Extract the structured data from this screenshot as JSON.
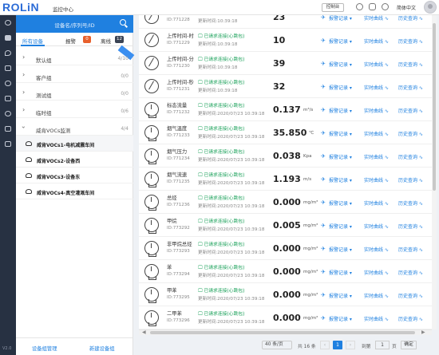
{
  "header": {
    "brand": "ROLiN",
    "app_title": "监控中心",
    "control_label": "控制台",
    "language": "简体中文"
  },
  "sidebar_rail": {
    "version": "V2.0"
  },
  "left_panel": {
    "search_placeholder": "设备名/序列号/ID",
    "tabs": [
      {
        "label": "所有设备",
        "active": true
      },
      {
        "label": "报警",
        "count": "0",
        "color": "#e8602c"
      },
      {
        "label": "离线",
        "count": "12",
        "color": "#3a4354"
      }
    ],
    "groups": [
      {
        "label": "默认组",
        "count": "4/10"
      },
      {
        "label": "客户组",
        "count": "0/0"
      },
      {
        "label": "测试组",
        "count": "0/0"
      },
      {
        "label": "临时组",
        "count": "0/6"
      },
      {
        "label": "威肯VOCs监测",
        "count": "4/4",
        "expanded": true
      }
    ],
    "devices": [
      {
        "label": "威肯VOCs1-电机减震车间"
      },
      {
        "label": "威肯VOCs2-设备西"
      },
      {
        "label": "威肯VOCs3-设备东"
      },
      {
        "label": "威肯VOCs4-真空灌溉车间"
      }
    ],
    "footer": {
      "manage": "设备组管理",
      "add": "新建设备组"
    }
  },
  "rows": [
    {
      "name": "上传时间-时",
      "id": "ID:771228",
      "status": "已请求连接(心跳包)",
      "time": "更新时间:10:39:18",
      "value": "23",
      "unit": "",
      "icon": "compass-icon"
    },
    {
      "name": "上传时间-时",
      "id": "ID:771229",
      "status": "已请求连接(心跳包)",
      "time": "更新时间:10:39:18",
      "value": "10",
      "unit": "",
      "icon": "compass-icon"
    },
    {
      "name": "上传时间-分",
      "id": "ID:771230",
      "status": "已请求连接(心跳包)",
      "time": "更新时间:10:39:18",
      "value": "39",
      "unit": "",
      "icon": "compass-icon"
    },
    {
      "name": "上传时间-秒",
      "id": "ID:771231",
      "status": "已请求连接(心跳包)",
      "time": "更新时间:10:39:18",
      "value": "32",
      "unit": "",
      "icon": "compass-icon"
    },
    {
      "name": "标态流量",
      "id": "ID:771232",
      "status": "已请求连接(心跳包)",
      "time": "更新时间:2020/07/23 10:39:18",
      "value": "0.137",
      "unit": "m³/s",
      "icon": "gauge-icon"
    },
    {
      "name": "烟气温度",
      "id": "ID:771233",
      "status": "已请求连接(心跳包)",
      "time": "更新时间:2020/07/23 10:39:18",
      "value": "35.850",
      "unit": "℃",
      "icon": "gauge-icon"
    },
    {
      "name": "烟气压力",
      "id": "ID:771234",
      "status": "已请求连接(心跳包)",
      "time": "更新时间:2020/07/23 10:39:18",
      "value": "0.038",
      "unit": "Kpa",
      "icon": "gauge-icon"
    },
    {
      "name": "烟气流速",
      "id": "ID:771235",
      "status": "已请求连接(心跳包)",
      "time": "更新时间:2020/07/23 10:39:18",
      "value": "1.193",
      "unit": "m/s",
      "icon": "gauge-icon"
    },
    {
      "name": "总烃",
      "id": "ID:771236",
      "status": "已请求连接(心跳包)",
      "time": "更新时间:2020/07/23 10:39:18",
      "value": "0.000",
      "unit": "mg/m³",
      "icon": "gauge-icon"
    },
    {
      "name": "甲烷",
      "id": "ID:773292",
      "status": "已请求连接(心跳包)",
      "time": "更新时间:2020/07/23 10:39:18",
      "value": "0.005",
      "unit": "mg/m³",
      "icon": "gauge-icon"
    },
    {
      "name": "非甲烷总烃",
      "id": "ID:773293",
      "status": "已请求连接(心跳包)",
      "time": "更新时间:2020/07/23 10:39:18",
      "value": "0.000",
      "unit": "mg/m³",
      "icon": "gauge-icon"
    },
    {
      "name": "苯",
      "id": "ID:773294",
      "status": "已请求连接(心跳包)",
      "time": "更新时间:2020/07/23 10:39:18",
      "value": "0.000",
      "unit": "mg/m³",
      "icon": "gauge-icon"
    },
    {
      "name": "甲苯",
      "id": "ID:773295",
      "status": "已请求连接(心跳包)",
      "time": "更新时间:2020/07/23 10:39:18",
      "value": "0.000",
      "unit": "mg/m³",
      "icon": "gauge-icon"
    },
    {
      "name": "二甲苯",
      "id": "ID:773296",
      "status": "已请求连接(心跳包)",
      "time": "更新时间:2020/07/23 10:39:18",
      "value": "0.000",
      "unit": "mg/m³",
      "icon": "gauge-icon"
    }
  ],
  "row_actions": {
    "alarm": "报警记录",
    "realtime": "实时曲线",
    "history": "历史查询"
  },
  "pagination": {
    "page_size": "40 条/页",
    "total": "共 16 条",
    "current_page": "1",
    "goto_label": "到第",
    "goto_value": "1",
    "page_suffix": "页",
    "confirm": "确定"
  }
}
